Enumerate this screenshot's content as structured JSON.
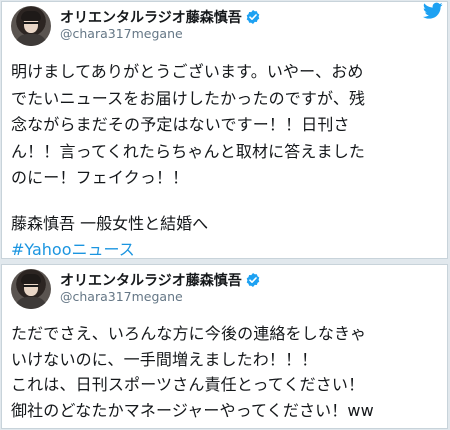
{
  "colors": {
    "accent": "#1b95e0",
    "verified": "#1da1f2",
    "text": "#14171a",
    "muted": "#657786"
  },
  "tweets": [
    {
      "display_name": "オリエンタルラジオ藤森慎吾",
      "handle": "@chara317megane",
      "verified_icon": "verified-badge-icon",
      "body": "明けましてありがとうございます。いやー、おめ\nでたいニュースをお届けしたかったのですが、残\n念ながらまだその予定はないですー！！日刊さ\nん！！言ってくれたらちゃんと取材に答えました\nのにー！フェイクっ！！",
      "link_title": "藤森慎吾 一般女性と結婚へ",
      "hashtag": "#Yahooニュース"
    },
    {
      "display_name": "オリエンタルラジオ藤森慎吾",
      "handle": "@chara317megane",
      "verified_icon": "verified-badge-icon",
      "body": "ただでさえ、いろんな方に今後の連絡をしなきゃ\nいけないのに、一手間増えましたわ！！！\nこれは、日刊スポーツさん責任とってください！\n御社のどなたかマネージャーやってください！ww"
    }
  ]
}
